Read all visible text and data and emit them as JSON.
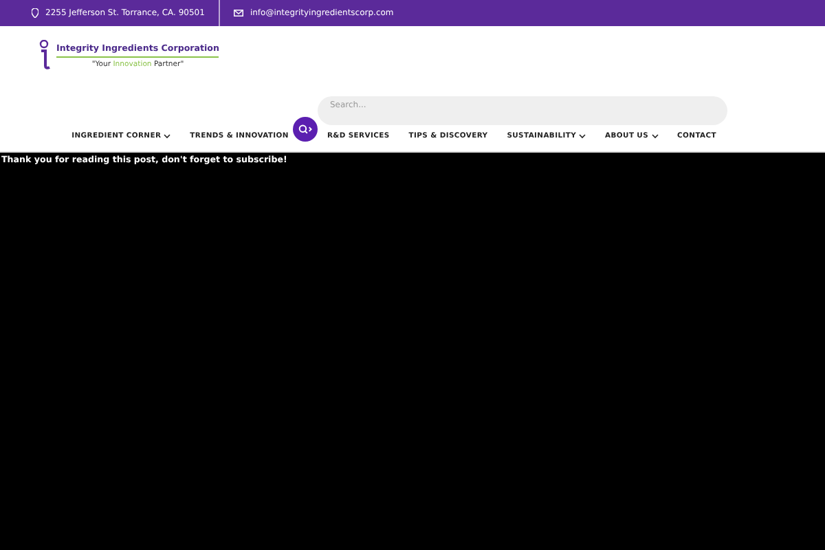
{
  "top_bar": {
    "address": "2255 Jefferson St. Torrance, CA. 90501",
    "email": "info@integrityingredientscorp.com"
  },
  "logo": {
    "name": "Integrity Ingredients Corporation",
    "tagline": [
      {
        "text": "\"Your ",
        "highlight": false
      },
      {
        "text": "Innovation",
        "highlight": true
      },
      {
        "text": " Partner\"",
        "highlight": false
      }
    ]
  },
  "search": {
    "placeholder": "Search..."
  },
  "nav": [
    {
      "label": "INGREDIENT CORNER",
      "has_menu": true
    },
    {
      "label": "TRENDS & INNOVATION",
      "has_menu": false
    },
    {
      "label": "R&D SERVICES",
      "has_menu": false
    },
    {
      "label": "TIPS & DISCOVERY",
      "has_menu": false
    },
    {
      "label": "SUSTAINABILITY",
      "has_menu": true
    },
    {
      "label": "ABOUT US",
      "has_menu": true
    },
    {
      "label": "CONTACT",
      "has_menu": false
    }
  ],
  "content": {
    "message": "Thank you for reading this post, don't forget to subscribe!"
  }
}
